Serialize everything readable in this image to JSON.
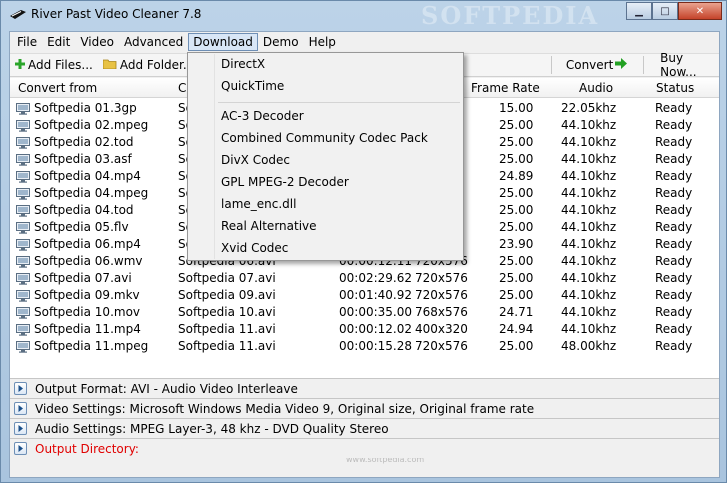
{
  "window": {
    "title": "River Past Video Cleaner 7.8",
    "watermark": "SOFTPEDIA",
    "watermark_small": "www.softpedia.com"
  },
  "menu": [
    "File",
    "Edit",
    "Video",
    "Advanced",
    "Download",
    "Demo",
    "Help"
  ],
  "menu_open": "Download",
  "toolbar": {
    "add_files": "Add Files...",
    "add_folder": "Add Folder...",
    "convert": "Convert",
    "buy_now": "Buy Now..."
  },
  "columns": {
    "convert_from": "Convert from",
    "convert_to": "C",
    "frame_rate": "Frame Rate",
    "audio": "Audio",
    "status": "Status"
  },
  "rows": [
    {
      "from": "Softpedia 01.3gp",
      "to": "So",
      "duration": "",
      "size": "",
      "fps": "15.00",
      "audio": "22.05khz",
      "status": "Ready"
    },
    {
      "from": "Softpedia 02.mpeg",
      "to": "So",
      "duration": "",
      "size": "",
      "fps": "25.00",
      "audio": "44.10khz",
      "status": "Ready"
    },
    {
      "from": "Softpedia 02.tod",
      "to": "So",
      "duration": "",
      "size": "",
      "fps": "25.00",
      "audio": "44.10khz",
      "status": "Ready"
    },
    {
      "from": "Softpedia 03.asf",
      "to": "So",
      "duration": "",
      "size": "",
      "fps": "25.00",
      "audio": "44.10khz",
      "status": "Ready"
    },
    {
      "from": "Softpedia 04.mp4",
      "to": "So",
      "duration": "",
      "size": "",
      "fps": "24.89",
      "audio": "44.10khz",
      "status": "Ready"
    },
    {
      "from": "Softpedia 04.mpeg",
      "to": "So",
      "duration": "",
      "size": "",
      "fps": "25.00",
      "audio": "44.10khz",
      "status": "Ready"
    },
    {
      "from": "Softpedia 04.tod",
      "to": "So",
      "duration": "",
      "size": "",
      "fps": "25.00",
      "audio": "44.10khz",
      "status": "Ready"
    },
    {
      "from": "Softpedia 05.flv",
      "to": "So",
      "duration": "",
      "size": "",
      "fps": "25.00",
      "audio": "44.10khz",
      "status": "Ready"
    },
    {
      "from": "Softpedia 06.mp4",
      "to": "So",
      "duration": "",
      "size": "",
      "fps": "23.90",
      "audio": "44.10khz",
      "status": "Ready"
    },
    {
      "from": "Softpedia 06.wmv",
      "to": "Softpedia 06.avi",
      "duration": "00:00:12.11",
      "size": "720x576",
      "fps": "25.00",
      "audio": "44.10khz",
      "status": "Ready"
    },
    {
      "from": "Softpedia 07.avi",
      "to": "Softpedia 07.avi",
      "duration": "00:02:29.62",
      "size": "720x576",
      "fps": "25.00",
      "audio": "44.10khz",
      "status": "Ready"
    },
    {
      "from": "Softpedia 09.mkv",
      "to": "Softpedia 09.avi",
      "duration": "00:01:40.92",
      "size": "720x576",
      "fps": "25.00",
      "audio": "44.10khz",
      "status": "Ready"
    },
    {
      "from": "Softpedia 10.mov",
      "to": "Softpedia 10.avi",
      "duration": "00:00:35.00",
      "size": "768x576",
      "fps": "24.71",
      "audio": "44.10khz",
      "status": "Ready"
    },
    {
      "from": "Softpedia 11.mp4",
      "to": "Softpedia 11.avi",
      "duration": "00:00:12.02",
      "size": "400x320",
      "fps": "24.94",
      "audio": "44.10khz",
      "status": "Ready"
    },
    {
      "from": "Softpedia 11.mpeg",
      "to": "Softpedia 11.avi",
      "duration": "00:00:15.28",
      "size": "720x576",
      "fps": "25.00",
      "audio": "48.00khz",
      "status": "Ready"
    }
  ],
  "settings": [
    {
      "label": "Output Format: AVI - Audio Video Interleave",
      "warning": false
    },
    {
      "label": "Video Settings: Microsoft Windows Media Video 9, Original size, Original frame rate",
      "warning": false
    },
    {
      "label": "Audio Settings: MPEG Layer-3, 48 khz - DVD Quality Stereo",
      "warning": false
    },
    {
      "label": "Output Directory:",
      "warning": true
    }
  ],
  "download_menu": {
    "group1": [
      "DirectX",
      "QuickTime"
    ],
    "group2": [
      "AC-3 Decoder",
      "Combined Community Codec Pack",
      "DivX Codec",
      "GPL MPEG-2 Decoder",
      "lame_enc.dll",
      "Real Alternative",
      "Xvid Codec"
    ]
  },
  "colors": {
    "warning_text": "#e00000",
    "menu_highlight": "#d8e6f6",
    "convert_arrow": "#22a022",
    "add_plus": "#2aa52a",
    "folder": "#e8c244"
  },
  "icons": {
    "app": "app-icon",
    "add_files": "plus-icon",
    "add_folder": "folder-icon",
    "convert": "arrow-right-icon",
    "file_row": "monitor-icon",
    "expand": "expand-arrow-icon"
  }
}
